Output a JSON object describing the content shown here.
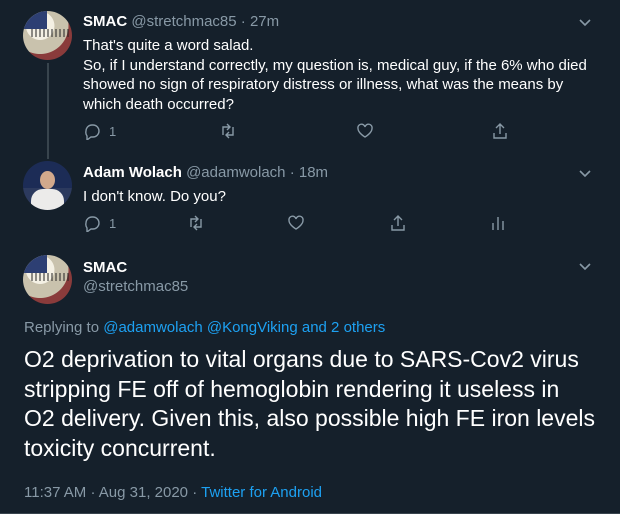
{
  "tweets": [
    {
      "name": "SMAC",
      "handle": "@stretchmac85",
      "separator": "·",
      "time": "27m",
      "lines": [
        "That's quite a word salad.",
        "So, if I understand correctly, my question  is, medical guy, if the 6% who died",
        "showed no sign of respiratory distress or illness, what was the means by",
        "which death occurred?"
      ],
      "reply_count": "1"
    },
    {
      "name": "Adam Wolach",
      "handle": "@adamwolach",
      "separator": "·",
      "time": "18m",
      "lines": [
        "I don't know. Do you?"
      ],
      "reply_count": "1"
    }
  ],
  "main_tweet": {
    "name": "SMAC",
    "handle": "@stretchmac85",
    "replying_prefix": "Replying to",
    "replying_user1": "@adamwolach",
    "replying_user2": "@KongViking",
    "replying_suffix": "and 2 others",
    "lines": [
      "O2 deprivation to vital organs due to SARS-Cov2 virus",
      "stripping FE off of hemoglobin rendering it useless in",
      "O2 delivery. Given this, also  possible high FE iron levels",
      "toxicity concurrent."
    ],
    "time": "11:37 AM",
    "date": "Aug 31, 2020",
    "separator": "·",
    "source": "Twitter for Android"
  },
  "colors": {
    "background": "#15202b",
    "text": "#ffffff",
    "muted": "#8899a6",
    "accent": "#1da1f2",
    "border": "#38444d"
  },
  "icons": [
    "reply-icon",
    "retweet-icon",
    "like-icon",
    "share-icon",
    "analytics-icon",
    "chevron-down-icon"
  ]
}
